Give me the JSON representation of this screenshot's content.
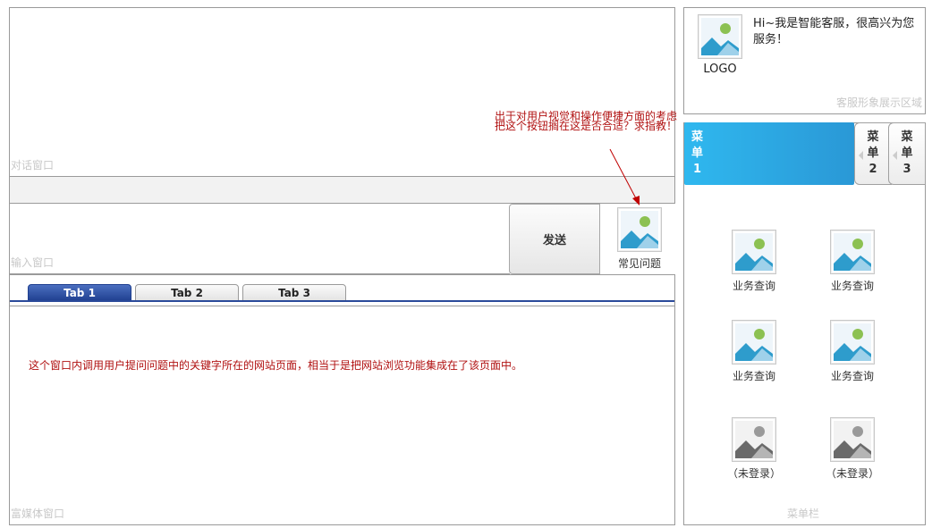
{
  "chat": {
    "label": "对话窗口"
  },
  "input": {
    "label": "输入窗口",
    "send_label": "发送",
    "faq_label": "常见问题"
  },
  "annotation_top": {
    "line1": "出于对用户视觉和操作便捷方面的考虑",
    "line2": "把这个按钮搁在这是否合适？求指教！"
  },
  "tabs": [
    {
      "label": "Tab 1"
    },
    {
      "label": "Tab 2"
    },
    {
      "label": "Tab 3"
    }
  ],
  "rich": {
    "label": "富媒体窗口",
    "note": "这个窗口内调用用户提问问题中的关键字所在的网站页面，相当于是把网站浏览功能集成在了该页面中。"
  },
  "service": {
    "logo_caption": "LOGO",
    "greeting": "Hi~我是智能客服，很高兴为您服务！",
    "label": "客服形象展示区域"
  },
  "menu": {
    "tabs": [
      {
        "chars": [
          "菜",
          "单",
          "1"
        ]
      },
      {
        "chars": [
          "菜",
          "单",
          "2"
        ]
      },
      {
        "chars": [
          "菜",
          "单",
          "3"
        ]
      }
    ],
    "items": [
      {
        "label": "业务查询"
      },
      {
        "label": "业务查询"
      },
      {
        "label": "业务查询"
      },
      {
        "label": "业务查询"
      },
      {
        "label": "（未登录）"
      },
      {
        "label": "（未登录）"
      }
    ],
    "label": "菜单栏"
  },
  "colors": {
    "accent_blue": "#2fb8ef",
    "tab_active": "#1f3f8f",
    "note_red": "#b01010"
  },
  "icons": {
    "image_placeholder": "image-placeholder-icon",
    "arrow": "arrow-annotation"
  }
}
